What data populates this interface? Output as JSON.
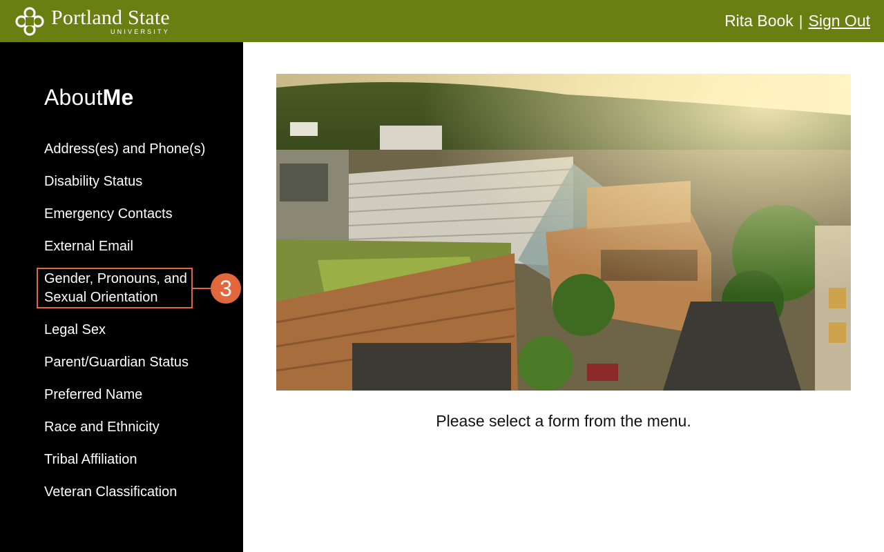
{
  "header": {
    "brand_name": "Portland State",
    "brand_sub": "UNIVERSITY",
    "user_name": "Rita Book",
    "separator": "|",
    "sign_out_label": "Sign Out",
    "bar_color": "#6a7f12"
  },
  "sidebar": {
    "title_light": "About",
    "title_bold": "Me",
    "items": [
      {
        "label": "Address(es) and Phone(s)"
      },
      {
        "label": "Disability Status"
      },
      {
        "label": "Emergency Contacts"
      },
      {
        "label": "External Email"
      },
      {
        "label": "Gender, Pronouns, and Sexual Orientation",
        "highlighted": true
      },
      {
        "label": "Legal Sex"
      },
      {
        "label": "Parent/Guardian Status"
      },
      {
        "label": "Preferred Name"
      },
      {
        "label": "Race and Ethnicity"
      },
      {
        "label": "Tribal Affiliation"
      },
      {
        "label": "Veteran Classification"
      }
    ],
    "callout_number": "3",
    "callout_color": "#e2673d"
  },
  "main": {
    "image_icon": "campus-aerial-photo",
    "prompt": "Please select a form from the menu."
  }
}
